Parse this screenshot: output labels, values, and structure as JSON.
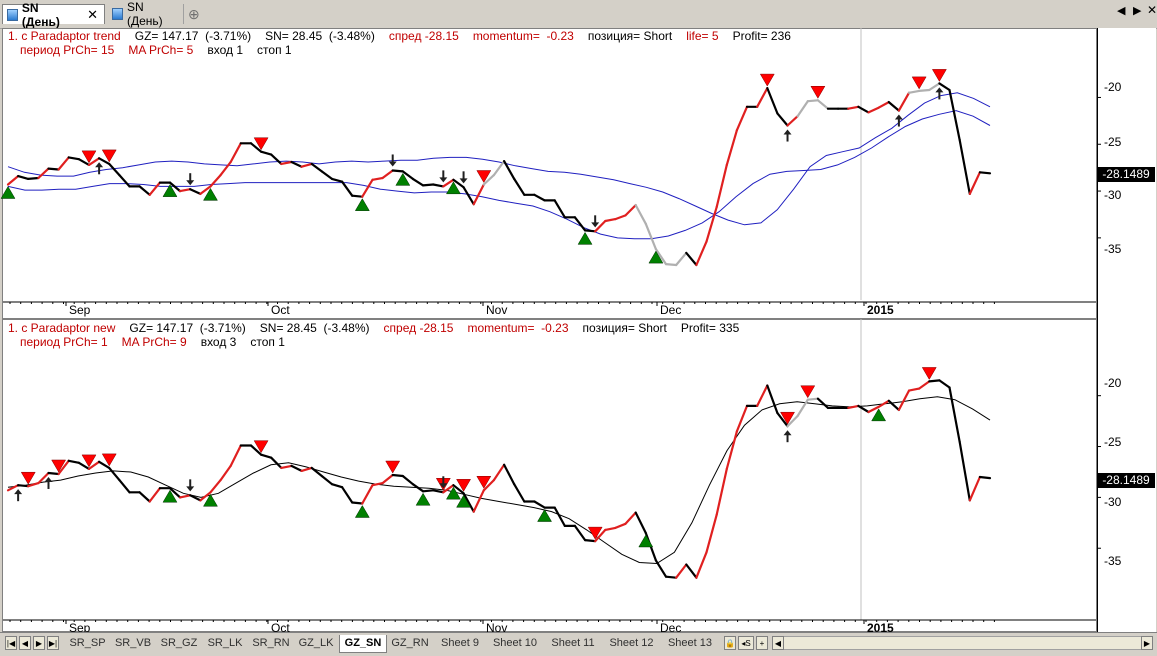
{
  "tabs": [
    {
      "label": "SN (День)",
      "active": true
    },
    {
      "label": "SN (День)",
      "active": false
    }
  ],
  "colors": {
    "up": "#e02020",
    "down": "#000000",
    "neutral": "#b0b0b0",
    "band": "#2020c0",
    "buy": "#008000",
    "sell": "#ff0000"
  },
  "top_panel": {
    "legend_line1": [
      {
        "text": "1. c Paradaptor trend",
        "color": "#c00000"
      },
      {
        "text": "GZ= 147.17  (-3.71%)",
        "color": "#000000"
      },
      {
        "text": "SN= 28.45  (-3.48%)",
        "color": "#000000"
      },
      {
        "text": "спред -28.15",
        "color": "#c00000"
      },
      {
        "text": "momentum=  -0.23",
        "color": "#c00000"
      },
      {
        "text": "позиция= Short",
        "color": "#000000"
      },
      {
        "text": "life= 5",
        "color": "#c00000"
      },
      {
        "text": "Profit= 236",
        "color": "#000000"
      }
    ],
    "legend_line2": [
      {
        "text": "период PrCh= 15",
        "color": "#c00000"
      },
      {
        "text": "MA PrCh= 5",
        "color": "#c00000"
      },
      {
        "text": "вход 1",
        "color": "#000000"
      },
      {
        "text": "стоп 1",
        "color": "#000000"
      }
    ],
    "y_ticks": [
      "-20",
      "-25",
      "-30",
      "-35"
    ],
    "last_price": "-28.1489",
    "x_ticks": [
      "Sep",
      "Oct",
      "Nov",
      "Dec",
      "2015"
    ]
  },
  "bottom_panel": {
    "legend_line1": [
      {
        "text": "1. c Paradaptor new",
        "color": "#c00000"
      },
      {
        "text": "GZ= 147.17  (-3.71%)",
        "color": "#000000"
      },
      {
        "text": "SN= 28.45  (-3.48%)",
        "color": "#000000"
      },
      {
        "text": "спред -28.15",
        "color": "#c00000"
      },
      {
        "text": "momentum=  -0.23",
        "color": "#c00000"
      },
      {
        "text": "позиция= Short",
        "color": "#000000"
      },
      {
        "text": "Profit= 335",
        "color": "#000000"
      }
    ],
    "legend_line2": [
      {
        "text": "период PrCh= 1",
        "color": "#c00000"
      },
      {
        "text": "MA PrCh= 9",
        "color": "#c00000"
      },
      {
        "text": "вход 3",
        "color": "#000000"
      },
      {
        "text": "стоп 1",
        "color": "#000000"
      }
    ],
    "y_ticks": [
      "-20",
      "-25",
      "-30",
      "-35"
    ],
    "last_price": "-28.1489",
    "x_ticks": [
      "Sep",
      "Oct",
      "Nov",
      "Dec",
      "2015"
    ]
  },
  "sheet_tabs": [
    "SR_SP",
    "SR_VB",
    "SR_GZ",
    "SR_LK",
    "SR_RN",
    "GZ_LK",
    "GZ_SN",
    "GZ_RN",
    "Sheet 9",
    "Sheet 10",
    "Sheet 11",
    "Sheet 12",
    "Sheet 13"
  ],
  "active_sheet": "GZ_SN",
  "chart_data": [
    {
      "type": "line",
      "title": "1. c Paradaptor trend",
      "ylim": [
        -39.5,
        -16
      ],
      "x_labels": [
        "Sep",
        "Oct",
        "Nov",
        "Dec",
        "2015"
      ],
      "series": [
        {
          "values": [
            -29.3,
            -28.4,
            -28.7,
            -28.6,
            -27.6,
            -27.7,
            -26.4,
            -26.6,
            -27.2,
            -26.5,
            -27.1,
            -28.3,
            -29.5,
            -29.5,
            -30.4,
            -29.1,
            -29.1,
            -30.0,
            -29.8,
            -30.3,
            -29.5,
            -28.3,
            -26.9,
            -24.9,
            -24.9,
            -25.8,
            -26.1,
            -27.1,
            -26.9,
            -27.4,
            -27.1,
            -27.9,
            -28.7,
            -29.0,
            -30.5,
            -30.6,
            -28.8,
            -28.6,
            -27.8,
            -27.9,
            -28.7,
            -29.4,
            -29.3,
            -29.5,
            -28.8,
            -29.6,
            -31.4,
            -29.3,
            -28.3,
            -26.8,
            -28.7,
            -30.4,
            -30.4,
            -31.0,
            -31.0,
            -32.8,
            -32.8,
            -34.2,
            -34.3,
            -33.2,
            -33.0,
            -32.6,
            -31.5,
            -33.5,
            -36.2,
            -37.8,
            -37.9,
            -36.6,
            -37.9,
            -35.4,
            -31.7,
            -27.2,
            -23.5,
            -21.0,
            -21.0,
            -19.0,
            -21.7,
            -23.0,
            -22.0,
            -20.4,
            -20.3,
            -21.2,
            -21.2,
            -21.2,
            -21.0,
            -21.6,
            -21.1,
            -20.5,
            -21.4,
            -19.5,
            -19.3,
            -19.2,
            -18.5,
            -19.2,
            -24.5,
            -30.3,
            -28.0,
            -28.1
          ]
        },
        {
          "name": "upper",
          "values": [
            -27.4,
            -28.0,
            -28.3,
            -28.4,
            -28.4,
            -28.0,
            -27.7,
            -27.5,
            -27.2,
            -26.9,
            -26.8,
            -26.9,
            -27.1,
            -27.2,
            -27.3,
            -27.1,
            -26.9,
            -26.8,
            -26.9,
            -27.1,
            -26.9,
            -26.8,
            -26.9,
            -26.8,
            -26.7,
            -26.7,
            -26.5,
            -26.4,
            -26.4,
            -26.6,
            -26.9,
            -27.3,
            -27.6,
            -27.9,
            -28.0,
            -28.2,
            -28.5,
            -28.8,
            -29.2,
            -29.6,
            -30.1,
            -30.8,
            -31.6,
            -32.4,
            -33.1,
            -33.6,
            -33.4,
            -32.0,
            -29.8,
            -27.4,
            -26.2,
            -25.8,
            -25.4,
            -24.3,
            -23.3,
            -21.9,
            -20.6,
            -19.8,
            -19.5,
            -20.1,
            -21.0
          ]
        },
        {
          "name": "lower",
          "values": [
            -29.5,
            -29.9,
            -29.9,
            -29.8,
            -29.8,
            -29.5,
            -29.2,
            -29.2,
            -29.3,
            -29.5,
            -29.5,
            -29.5,
            -29.3,
            -29.2,
            -29.1,
            -29.1,
            -29.1,
            -29.1,
            -29.1,
            -29.1,
            -29.1,
            -29.4,
            -29.8,
            -30.0,
            -30.2,
            -30.1,
            -30.1,
            -30.3,
            -30.6,
            -31.0,
            -31.3,
            -31.6,
            -32.2,
            -33.0,
            -33.9,
            -34.6,
            -35.0,
            -35.1,
            -35.1,
            -34.8,
            -34.2,
            -33.4,
            -32.2,
            -30.6,
            -29.2,
            -28.2,
            -27.9,
            -27.8,
            -27.7,
            -27.2,
            -26.4,
            -25.4,
            -24.2,
            -23.1,
            -22.3,
            -21.8,
            -21.4,
            -22.0,
            -23.0
          ]
        }
      ]
    },
    {
      "type": "line",
      "title": "1. c Paradaptor new",
      "ylim": [
        -39.5,
        -16
      ],
      "x_labels": [
        "Sep",
        "Oct",
        "Nov",
        "Dec",
        "2015"
      ],
      "series": [
        {
          "values": [
            -29.3,
            -28.8,
            -28.9,
            -28.6,
            -27.6,
            -27.7,
            -26.4,
            -26.6,
            -27.2,
            -26.5,
            -27.1,
            -28.3,
            -29.5,
            -29.5,
            -30.4,
            -29.1,
            -29.1,
            -30.0,
            -29.8,
            -30.3,
            -29.5,
            -28.3,
            -26.9,
            -24.9,
            -24.9,
            -25.8,
            -26.1,
            -27.1,
            -26.9,
            -27.4,
            -27.1,
            -27.9,
            -28.7,
            -29.0,
            -30.5,
            -30.6,
            -28.8,
            -28.6,
            -27.8,
            -27.9,
            -28.7,
            -29.4,
            -29.3,
            -29.5,
            -28.8,
            -29.6,
            -31.4,
            -29.3,
            -28.3,
            -26.8,
            -28.7,
            -30.4,
            -30.4,
            -31.0,
            -31.0,
            -32.8,
            -32.8,
            -34.2,
            -34.3,
            -33.2,
            -33.0,
            -32.6,
            -31.5,
            -33.5,
            -36.2,
            -37.8,
            -37.9,
            -36.6,
            -37.9,
            -35.4,
            -31.7,
            -27.2,
            -23.5,
            -21.0,
            -21.0,
            -19.0,
            -21.7,
            -23.0,
            -22.0,
            -20.4,
            -20.3,
            -21.2,
            -21.2,
            -21.2,
            -21.0,
            -21.6,
            -21.1,
            -20.5,
            -21.4,
            -19.5,
            -19.3,
            -18.6,
            -18.5,
            -19.2,
            -24.5,
            -30.3,
            -28.0,
            -28.1
          ]
        },
        {
          "name": "ma",
          "values": [
            -29.0,
            -28.8,
            -28.5,
            -28.3,
            -27.9,
            -27.6,
            -27.4,
            -27.5,
            -28.0,
            -28.8,
            -29.6,
            -30.0,
            -29.6,
            -28.6,
            -27.6,
            -26.8,
            -26.6,
            -27.0,
            -27.5,
            -28.0,
            -28.4,
            -28.7,
            -28.9,
            -29.0,
            -29.1,
            -29.3,
            -29.7,
            -30.1,
            -30.4,
            -30.7,
            -31.0,
            -31.4,
            -32.1,
            -33.2,
            -34.4,
            -35.6,
            -36.4,
            -36.5,
            -35.4,
            -32.5,
            -28.8,
            -25.4,
            -22.9,
            -21.4,
            -20.8,
            -20.6,
            -20.8,
            -21.0,
            -21.1,
            -21.0,
            -20.8,
            -20.6,
            -20.3,
            -20.1,
            -20.4,
            -21.3,
            -22.4
          ]
        }
      ]
    }
  ]
}
